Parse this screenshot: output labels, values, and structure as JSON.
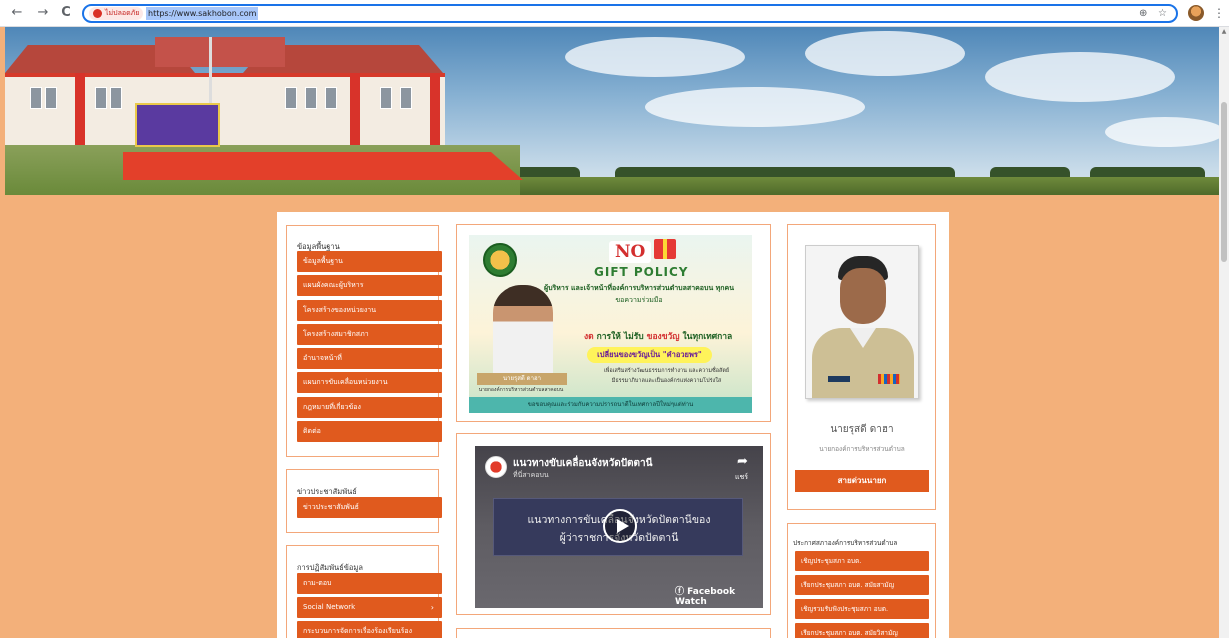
{
  "browser": {
    "security_label": "ไม่ปลอดภัย",
    "url": "https://www.sakhobon.com",
    "back_icon": "←",
    "forward_icon": "→",
    "reload_icon": "C",
    "zoom_icon": "⊕",
    "star_icon": "☆",
    "menu_icon": "⋮"
  },
  "left_sidebar": {
    "basic_info": {
      "title": "ข้อมูลพื้นฐาน",
      "items": [
        {
          "label": "ข้อมูลพื้นฐาน"
        },
        {
          "label": "แผนผังคณะผู้บริหาร"
        },
        {
          "label": "โครงสร้างของหน่วยงาน"
        },
        {
          "label": "โครงสร้างสมาชิกสภา"
        },
        {
          "label": "อำนาจหน้าที่"
        },
        {
          "label": "แผนการขับเคลื่อนหน่วยงาน"
        },
        {
          "label": "กฎหมายที่เกี่ยวข้อง"
        },
        {
          "label": "ติดต่อ"
        }
      ]
    },
    "news": {
      "title": "ข่าวประชาสัมพันธ์",
      "items": [
        {
          "label": "ข่าวประชาสัมพันธ์"
        }
      ]
    },
    "interaction": {
      "title": "การปฏิสัมพันธ์ข้อมูล",
      "items": [
        {
          "label": "ถาม-ตอบ"
        },
        {
          "label": "Social Network",
          "chevron": "›"
        },
        {
          "label": "กระบวนการจัดการเรื่องร้องเรียนร้อง"
        }
      ]
    }
  },
  "center": {
    "poster": {
      "no": "NO",
      "gift_policy": "GIFT POLICY",
      "line1": "ผู้บริหาร และเจ้าหน้าที่องค์การบริหารส่วนตำบลสาคอบน ทุกคน",
      "line2": "ขอความร่วมมือ",
      "gifts_prefix": "งด",
      "gifts_mid": " การให้ ไม่รับ ",
      "gifts_red": "ของขวัญ",
      "gifts_suffix": " ในทุกเทศกาล",
      "highlight": "เปลี่ยนของขวัญเป็น \"คำอวยพร\"",
      "desc1": "เพื่อเสริมสร้างวัฒนธรรมการทำงาน และความซื่อสัตย์",
      "desc2": "มีธรรมาภิบาลและเป็นองค์กรแห่งความโปร่งใส",
      "name_tag": "นายรุสดี ดาฮา",
      "position_tag": "นายกองค์การบริหารส่วนตำบลสาคอบน",
      "footer": "ขอขอบคุณและร่วมกับความปรารถนาดีในเทศกาลปีใหม่ๆแด่ท่าน"
    },
    "video": {
      "title": "แนวทางขับเคลื่อนจังหวัดปัตตานี",
      "subtitle": "ที่นี่สาคอบน",
      "share_icon": "➦",
      "share_label": "แชร์",
      "card_line1": "แนวทางการขับเคลื่อนจังหวัดปัตตานีของ",
      "card_line2": "ผู้ว่าราชการจังหวัดปัตตานี",
      "watch_label": "Facebook Watch"
    }
  },
  "right_sidebar": {
    "profile": {
      "name": "นายรุสดี ดาฮา",
      "position": "นายกองค์การบริหารส่วนตำบล",
      "button": "สายด่วนนายก"
    },
    "announcements": {
      "title": "ประกาศสภาองค์การบริหารส่วนตำบล",
      "items": [
        {
          "label": "เชิญประชุมสภา อบต."
        },
        {
          "label": "เรียกประชุมสภา อบต. สมัยสามัญ"
        },
        {
          "label": "เชิญรวมรับฟังประชุมสภา อบต."
        },
        {
          "label": "เรียกประชุมสภา อบต. สมัยวิสามัญ"
        }
      ]
    }
  },
  "colors": {
    "page_bg": "#f3b07a",
    "accent": "#e05a1e",
    "panel_border": "#f3a77a"
  }
}
